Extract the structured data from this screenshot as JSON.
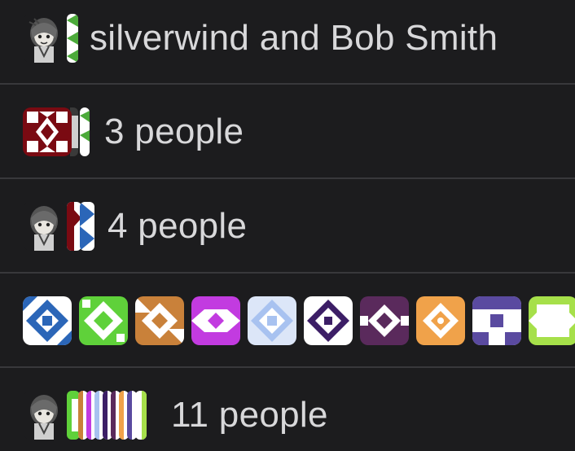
{
  "conversations": [
    {
      "label": "silverwind and Bob Smith"
    },
    {
      "label": "3 people"
    },
    {
      "label": "4 people"
    },
    {
      "label": ""
    },
    {
      "label": "11 people"
    }
  ],
  "avatar_palette": {
    "maroon": "#7a0a12",
    "green": "#5fd13a",
    "blue": "#2b66b8",
    "lightgreen": "#7fd34a",
    "orange": "#c9813a",
    "magenta": "#c23be0",
    "lightblue": "#a8c2f0",
    "purple": "#3c1e66",
    "plum": "#5a2a5c",
    "peach": "#f0a24a",
    "violet": "#5a4aa0",
    "lime": "#a6e04a"
  },
  "icons": [
    "user-photo-avatar",
    "identicon-avatar"
  ]
}
